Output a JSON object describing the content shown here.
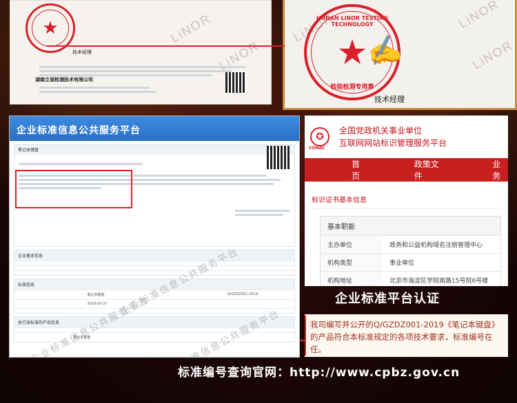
{
  "report_left": {
    "company_name": "湖南立诺检测技术有限公司",
    "signer_role": "技术经理",
    "watermark": "LiNOR"
  },
  "report_right": {
    "seal_text_top": "HUNAN LiNOR TESTING TECHNOLOGY",
    "seal_text_bottom": "检验检测专用章",
    "signer_role": "技术经理",
    "watermark": "LiNOR"
  },
  "platform_left": {
    "header_title": "企业标准信息公共服务平台",
    "notice_label": "笔记本键盘",
    "section_basic": "企业基本信息",
    "section_standard": "标准信息",
    "standard_number": "Q/GZDZ001-2019",
    "standard_name": "笔记本键盘",
    "date": "2019-03-27",
    "section_products": "执行该标准的产品信息",
    "product_name": "笔记本键盘",
    "watermark_text": "企业标准信息公共服务平台"
  },
  "gov_panel": {
    "title_line1": "全国党政机关事业单位",
    "title_line2": "互联网网站标识管理服务平台",
    "logo_label": "CONAC",
    "nav": [
      "首页",
      "政策文件",
      "业务"
    ],
    "cert_title": "标识证书基本信息",
    "info_head": "基本职能",
    "rows": [
      {
        "k": "主办单位",
        "v": "政务和公益机构域名注册管理中心"
      },
      {
        "k": "机构类型",
        "v": "事业单位"
      },
      {
        "k": "机构地址",
        "v": "北京市海淀区学院南路15号院6号楼"
      }
    ]
  },
  "caption_auth": "企业标准平台认证",
  "quote_text": "我司编写并公开的Q/GZDZ001-2019《笔记本键盘》的产品符合本标准规定的各项技术要求，标准编号在任。",
  "bottom_caption": "标准编号查询官网：http://www.cpbz.gov.cn",
  "colors": {
    "accent_red": "#d8202a",
    "nav_red": "#c81e1e",
    "platform_blue": "#2a6fc7"
  }
}
